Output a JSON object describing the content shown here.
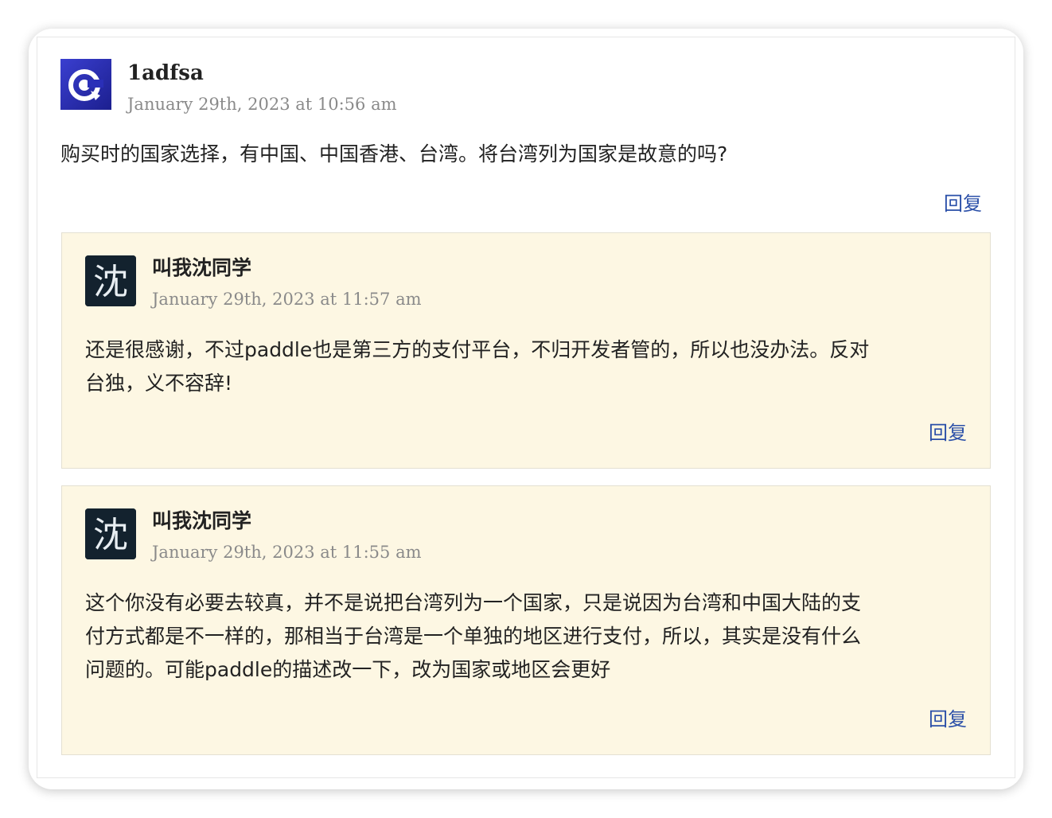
{
  "reply_label": "回复",
  "colors": {
    "reply_link": "#2a4fa8",
    "child_bg": "#fdf7e3",
    "date_text": "#8a8a8a"
  },
  "top_comment": {
    "avatar_icon": "blue-circle-logo-icon",
    "author": "1adfsa",
    "date": "January 29th, 2023 at 10:56 am",
    "text": "购买时的国家选择，有中国、中国香港、台湾。将台湾列为国家是故意的吗?"
  },
  "replies": [
    {
      "avatar_icon": "shen-character-avatar-icon",
      "avatar_glyph": "沈",
      "author": "叫我沈同学",
      "date": "January 29th, 2023 at 11:57 am",
      "text_lines": [
        "还是很感谢，不过paddle也是第三方的支付平台，不归开发者管的，所以也没办法。反对",
        "台独，义不容辞!"
      ]
    },
    {
      "avatar_icon": "shen-character-avatar-icon",
      "avatar_glyph": "沈",
      "author": "叫我沈同学",
      "date": "January 29th, 2023 at 11:55 am",
      "text_lines": [
        "这个你没有必要去较真，并不是说把台湾列为一个国家，只是说因为台湾和中国大陆的支",
        "付方式都是不一样的，那相当于台湾是一个单独的地区进行支付，所以，其实是没有什么",
        "问题的。可能paddle的描述改一下，改为国家或地区会更好"
      ]
    }
  ]
}
